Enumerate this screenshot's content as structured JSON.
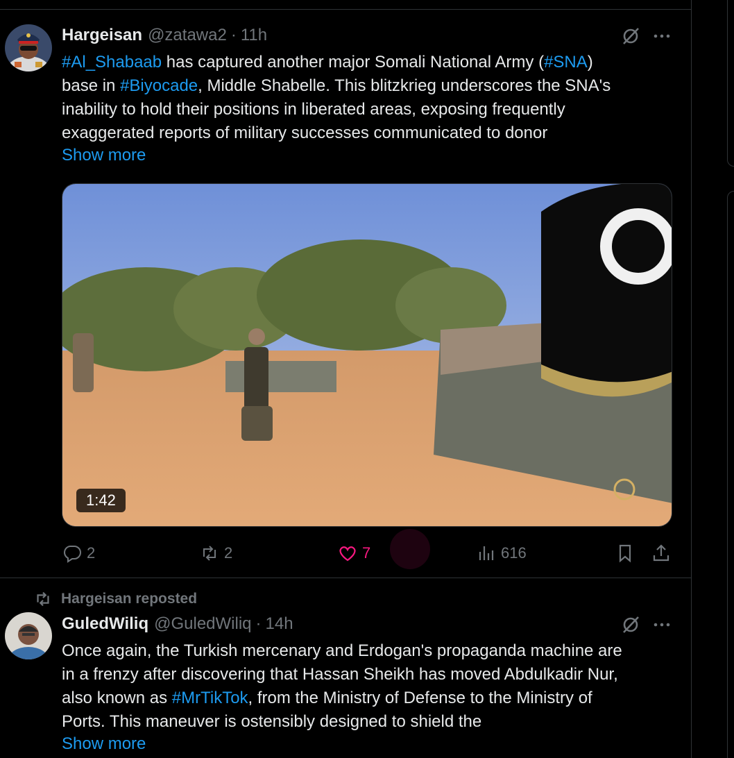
{
  "tweet1": {
    "name": "Hargeisan",
    "handle": "@zatawa2",
    "separator": "·",
    "time": "11h",
    "text_parts": {
      "h1": "#Al_Shabaab",
      "t1": " has captured another major Somali National Army (",
      "h2": "#SNA",
      "t2": ")",
      "t3": "base in ",
      "h3": "#Biyocade",
      "t4": ", Middle Shabelle. This blitzkrieg underscores the SNA's",
      "t5": "inability to hold their positions in liberated areas, exposing frequently",
      "t6": "exaggerated reports of military successes communicated to donor"
    },
    "show_more": "Show more",
    "video_duration": "1:42",
    "replies": "2",
    "reposts": "2",
    "likes": "7",
    "views": "616"
  },
  "repost_label": "Hargeisan reposted",
  "tweet2": {
    "name": "GuledWiliq",
    "handle": "@GuledWiliq",
    "separator": "·",
    "time": "14h",
    "text_parts": {
      "t1": "Once again, the Turkish mercenary and Erdogan's propaganda machine are",
      "t2": "in a frenzy after discovering that Hassan Sheikh has moved Abdulkadir Nur,",
      "t3": "also known as ",
      "h1": "#MrTikTok",
      "t4": ", from the Ministry of Defense to the Ministry of",
      "t5": "Ports. This maneuver is ostensibly designed to shield the"
    },
    "show_more": "Show more"
  },
  "icons": {
    "reply": "reply-icon",
    "repost": "repost-icon",
    "like": "heart-icon",
    "views": "views-icon",
    "bookmark": "bookmark-icon",
    "share": "share-icon",
    "grok": "grok-icon",
    "more": "more-icon"
  },
  "colors": {
    "background": "#000000",
    "text": "#e7e9ea",
    "secondary": "#71767b",
    "link": "#1d9bf0",
    "like": "#f91880",
    "border": "#2f3336"
  }
}
